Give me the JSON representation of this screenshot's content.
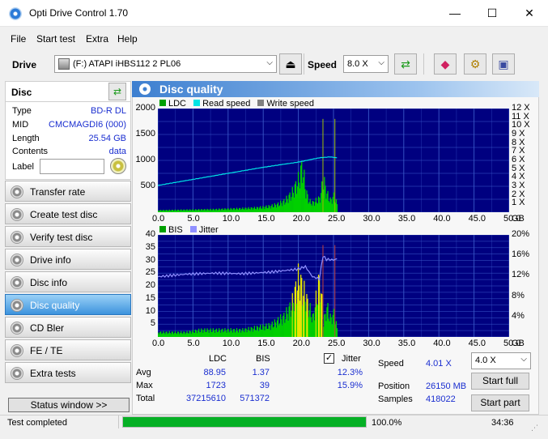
{
  "window": {
    "title": "Opti Drive Control 1.70",
    "minimize": "—",
    "maximize": "☐",
    "close": "✕"
  },
  "menu": [
    "File",
    "Start test",
    "Extra",
    "Help"
  ],
  "toolbar": {
    "drive_label": "Drive",
    "drive_value": "(F:)   ATAPI iHBS112   2 PL06",
    "speed_label": "Speed",
    "speed_value": "8.0 X"
  },
  "disc": {
    "heading": "Disc",
    "rows": [
      {
        "key": "Type",
        "value": "BD-R DL"
      },
      {
        "key": "MID",
        "value": "CMCMAGDI6 (000)"
      },
      {
        "key": "Length",
        "value": "25.54 GB"
      },
      {
        "key": "Contents",
        "value": "data"
      }
    ],
    "label_key": "Label"
  },
  "nav": [
    {
      "label": "Transfer rate",
      "active": false
    },
    {
      "label": "Create test disc",
      "active": false
    },
    {
      "label": "Verify test disc",
      "active": false
    },
    {
      "label": "Drive info",
      "active": false
    },
    {
      "label": "Disc info",
      "active": false
    },
    {
      "label": "Disc quality",
      "active": true
    },
    {
      "label": "CD Bler",
      "active": false
    },
    {
      "label": "FE / TE",
      "active": false
    },
    {
      "label": "Extra tests",
      "active": false
    }
  ],
  "status_window_label": "Status window >>",
  "panel_title": "Disc quality",
  "chart_data": [
    {
      "type": "area",
      "legend": [
        "LDC",
        "Read speed",
        "Write speed"
      ],
      "colors": {
        "LDC": "#00d000",
        "Read speed": "#00e5e5",
        "Write speed": "#a0a0a0",
        "bg": "#000080",
        "grid": "#3a58c8"
      },
      "x": {
        "min": 0,
        "max": 50,
        "ticks": [
          "0.0",
          "5.0",
          "10.0",
          "15.0",
          "20.0",
          "25.0",
          "30.0",
          "35.0",
          "40.0",
          "45.0",
          "50.0"
        ],
        "unit": "GB"
      },
      "y_left": {
        "min": 0,
        "max": 2000,
        "ticks": [
          "500",
          "1000",
          "1500",
          "2000"
        ]
      },
      "y_right": {
        "min": 0,
        "max": 12,
        "ticks": [
          "1 X",
          "2 X",
          "3 X",
          "4 X",
          "5 X",
          "6 X",
          "7 X",
          "8 X",
          "9 X",
          "10 X",
          "11 X",
          "12 X"
        ]
      },
      "series": [
        {
          "name": "LDC",
          "x": [
            0,
            2,
            4,
            6,
            8,
            10,
            12,
            14,
            15,
            16,
            17,
            18,
            19,
            20,
            20.5,
            21,
            21.5,
            22,
            23,
            23.5,
            24,
            24.5,
            25,
            25.5
          ],
          "y": [
            40,
            45,
            50,
            55,
            60,
            70,
            80,
            95,
            110,
            130,
            170,
            240,
            400,
            700,
            1000,
            450,
            230,
            200,
            300,
            700,
            400,
            250,
            350,
            150
          ]
        },
        {
          "name": "Read speed",
          "x": [
            0,
            5,
            10,
            15,
            20,
            23,
            24.5,
            25.5
          ],
          "y": [
            3.1,
            3.8,
            4.5,
            5.2,
            5.8,
            6.3,
            6.4,
            6.3
          ]
        }
      ]
    },
    {
      "type": "area",
      "legend": [
        "BIS",
        "Jitter"
      ],
      "colors": {
        "BIS": "#00d000",
        "BIS_peak": "#e8e800",
        "Jitter": "#9090ff",
        "bg": "#000080",
        "grid": "#3a58c8"
      },
      "x": {
        "min": 0,
        "max": 50,
        "ticks": [
          "0.0",
          "5.0",
          "10.0",
          "15.0",
          "20.0",
          "25.0",
          "30.0",
          "35.0",
          "40.0",
          "45.0",
          "50.0"
        ],
        "unit": "GB"
      },
      "y_left": {
        "min": 0,
        "max": 40,
        "ticks": [
          "5",
          "10",
          "15",
          "20",
          "25",
          "30",
          "35",
          "40"
        ]
      },
      "y_right": {
        "min": 0,
        "max": 20,
        "ticks": [
          "4%",
          "8%",
          "12%",
          "16%",
          "20%"
        ]
      },
      "series": [
        {
          "name": "BIS",
          "x": [
            0,
            2,
            4,
            6,
            8,
            10,
            12,
            14,
            16,
            18,
            19,
            20,
            21,
            22,
            23,
            23.5,
            24,
            24.5,
            25,
            25.5
          ],
          "y": [
            2,
            2,
            2,
            3,
            3,
            3,
            3,
            4,
            5,
            9,
            14,
            26,
            17,
            8,
            26,
            6,
            13,
            8,
            10,
            3
          ]
        },
        {
          "name": "Jitter",
          "x": [
            0,
            4,
            8,
            12,
            16,
            20,
            21,
            22,
            23,
            23.5,
            24,
            25,
            25.5
          ],
          "y": [
            11.8,
            12.3,
            12.5,
            12.4,
            12.7,
            13.3,
            13.8,
            11.8,
            11.4,
            15.9,
            15.2,
            15.1,
            15.3
          ]
        }
      ]
    }
  ],
  "stats": {
    "col_ldc": "LDC",
    "col_bis": "BIS",
    "jitter_label": "Jitter",
    "rows": [
      {
        "key": "Avg",
        "ldc": "88.95",
        "bis": "1.37",
        "jitter": "12.3%"
      },
      {
        "key": "Max",
        "ldc": "1723",
        "bis": "39",
        "jitter": "15.9%"
      },
      {
        "key": "Total",
        "ldc": "37215610",
        "bis": "571372",
        "jitter": ""
      }
    ],
    "speed_key": "Speed",
    "speed_value": "4.01 X",
    "position_key": "Position",
    "position_value": "26150 MB",
    "samples_key": "Samples",
    "samples_value": "418022",
    "speed_select": "4.0 X",
    "start_full": "Start full",
    "start_part": "Start part"
  },
  "statusbar": {
    "text": "Test completed",
    "progress": 100,
    "progress_text": "100.0%",
    "time": "34:36"
  }
}
